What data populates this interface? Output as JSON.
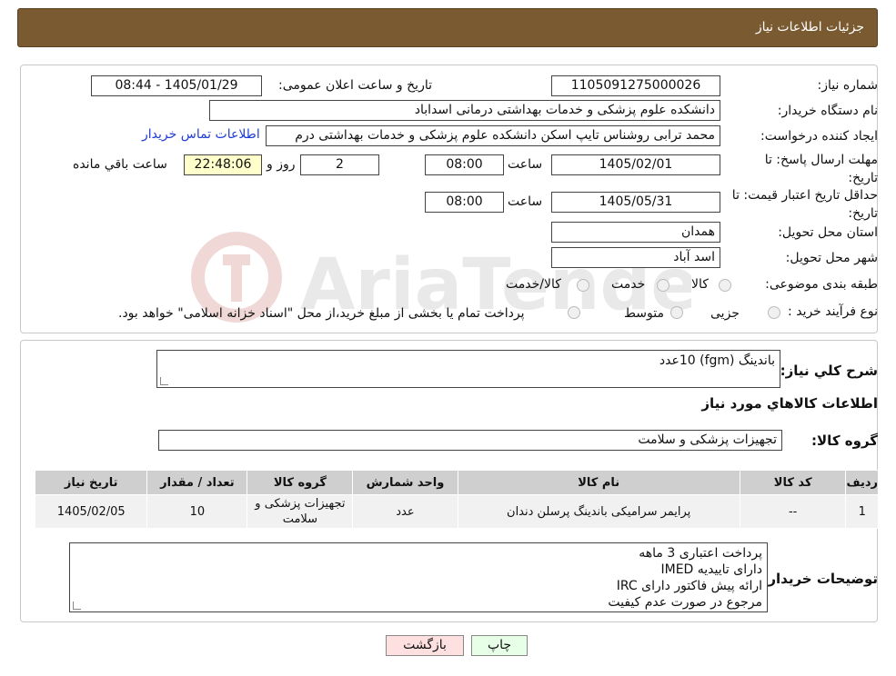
{
  "header": {
    "title": "جزئیات اطلاعات نیاز"
  },
  "form": {
    "need_number_label": "شماره نیاز:",
    "need_number": "1105091275000026",
    "announce_label": "تاریخ و ساعت اعلان عمومی:",
    "announce_value": "1405/01/29 - 08:44",
    "buyer_org_label": "نام دستگاه خریدار:",
    "buyer_org": "دانشکده علوم پزشکی و خدمات بهداشتی درمانی اسداباد",
    "creator_label": "ایجاد کننده درخواست:",
    "creator": "محمد ترابی روشناس تایپ اسکن دانشکده علوم پزشکی و خدمات بهداشتی درم",
    "contact_link": "اطلاعات تماس خریدار",
    "reply_deadline_label": "مهلت ارسال پاسخ: تا تاریخ:",
    "reply_date": "1405/02/01",
    "time_label": "ساعت",
    "reply_time": "08:00",
    "days_value": "2",
    "days_label": "روز و",
    "remaining_time": "22:48:06",
    "remaining_label": "ساعت باقي مانده",
    "price_validity_label": "حداقل تاریخ اعتبار قیمت: تا تاریخ:",
    "price_date": "1405/05/31",
    "price_time": "08:00",
    "province_label": "استان محل تحویل:",
    "province": "همدان",
    "city_label": "شهر محل تحویل:",
    "city": "اسد آباد",
    "category_label": "طبقه بندی موضوعی:",
    "category_options": [
      "کالا",
      "خدمت",
      "کالا/خدمت"
    ],
    "process_label": "نوع فرآیند خرید :",
    "process_options": [
      "جزیی",
      "متوسط"
    ],
    "process_note": "پرداخت تمام یا بخشی از مبلغ خرید،از محل \"اسناد خزانه اسلامی\" خواهد بود."
  },
  "watermark": {
    "text": "AriaTender.neT"
  },
  "details": {
    "summary_label": "شرح کلي نياز:",
    "summary": "باندینگ (fgm) 10عدد",
    "goods_info_title": "اطلاعات کالاهاي مورد نياز",
    "goods_group_label": "گروه کالا:",
    "goods_group": "تجهیزات پزشکی و سلامت",
    "table": {
      "headers": [
        "ردیف",
        "کد کالا",
        "نام کالا",
        "واحد شمارش",
        "گروه کالا",
        "تعداد / مقدار",
        "تاریخ نیاز"
      ],
      "rows": [
        [
          "1",
          "--",
          "پرایمر سرامیکی باندینگ پرسلن دندان",
          "عدد",
          "تجهیزات پزشکی و سلامت",
          "10",
          "1405/02/05"
        ]
      ]
    },
    "buyer_notes_label": "توضیحات خریدار:",
    "buyer_notes": [
      "پرداخت اعتباری 3 ماهه",
      "دارای تاییدیه IMED",
      "ارائه پیش فاکتور دارای IRC",
      "مرجوع در صورت عدم کیفیت"
    ]
  },
  "buttons": {
    "print": "چاپ",
    "back": "بازگشت"
  },
  "colors": {
    "header": "#7a5a30",
    "print_btn": "#e6ffe6",
    "back_btn": "#ffe0e0",
    "link": "#1f3cd6"
  }
}
